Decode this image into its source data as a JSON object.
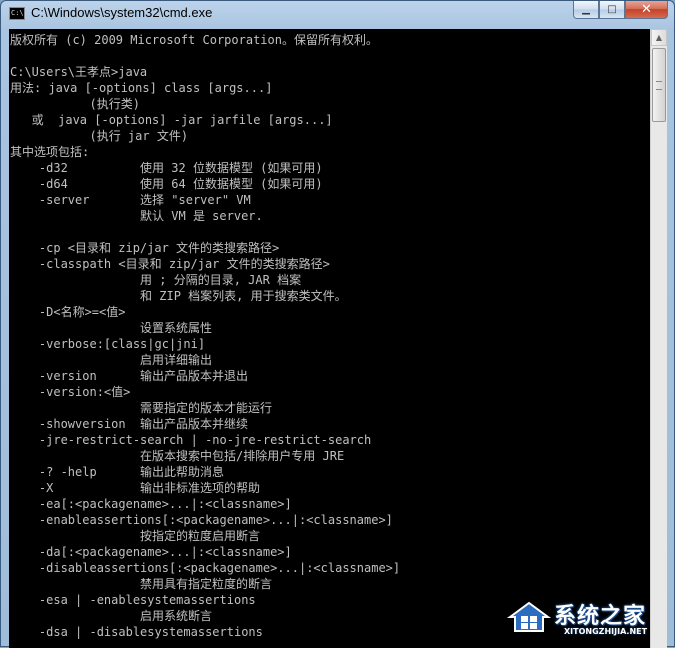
{
  "window": {
    "title": "C:\\Windows\\system32\\cmd.exe",
    "icon_text": "C:\\",
    "buttons": {
      "minimize": "▁",
      "maximize": "□",
      "close": "✕"
    }
  },
  "console": {
    "lines": [
      "版权所有 (c) 2009 Microsoft Corporation。保留所有权利。",
      "",
      "C:\\Users\\王孝点>java",
      "用法: java [-options] class [args...]",
      "           (执行类)",
      "   或  java [-options] -jar jarfile [args...]",
      "           (执行 jar 文件)",
      "其中选项包括:",
      "    -d32          使用 32 位数据模型 (如果可用)",
      "    -d64          使用 64 位数据模型 (如果可用)",
      "    -server       选择 \"server\" VM",
      "                  默认 VM 是 server.",
      "",
      "    -cp <目录和 zip/jar 文件的类搜索路径>",
      "    -classpath <目录和 zip/jar 文件的类搜索路径>",
      "                  用 ; 分隔的目录, JAR 档案",
      "                  和 ZIP 档案列表, 用于搜索类文件。",
      "    -D<名称>=<值>",
      "                  设置系统属性",
      "    -verbose:[class|gc|jni]",
      "                  启用详细输出",
      "    -version      输出产品版本并退出",
      "    -version:<值>",
      "                  需要指定的版本才能运行",
      "    -showversion  输出产品版本并继续",
      "    -jre-restrict-search | -no-jre-restrict-search",
      "                  在版本搜索中包括/排除用户专用 JRE",
      "    -? -help      输出此帮助消息",
      "    -X            输出非标准选项的帮助",
      "    -ea[:<packagename>...|:<classname>]",
      "    -enableassertions[:<packagename>...|:<classname>]",
      "                  按指定的粒度启用断言",
      "    -da[:<packagename>...|:<classname>]",
      "    -disableassertions[:<packagename>...|:<classname>]",
      "                  禁用具有指定粒度的断言",
      "    -esa | -enablesystemassertions",
      "                  启用系统断言",
      "    -dsa | -disablesystemassertions"
    ]
  },
  "scrollbar": {
    "up": "▲",
    "position_fraction": 0.0
  },
  "watermark": {
    "title": "系统之家",
    "subtitle": "XITONGZHIJIA.NET"
  },
  "colors": {
    "console_bg": "#000000",
    "console_fg": "#c0c0c0",
    "titlebar": "#bcd3ea"
  }
}
